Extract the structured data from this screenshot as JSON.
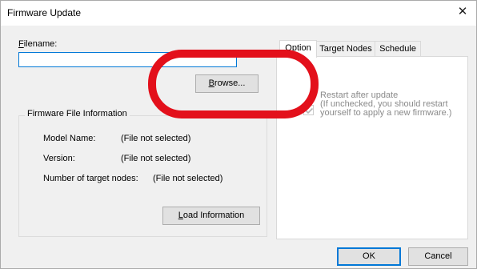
{
  "window": {
    "title": "Firmware Update",
    "close_symbol": "✕"
  },
  "filename": {
    "label_first": "F",
    "label_rest": "ilename:",
    "value": ""
  },
  "browse": {
    "label_first": "B",
    "label_rest": "rowse..."
  },
  "info_group": {
    "title": "Firmware File Information",
    "model_label": "Model Name:",
    "model_value": "(File not selected)",
    "version_label": "Version:",
    "version_value": "(File not selected)",
    "nodes_label": "Number of target nodes:",
    "nodes_value": "(File not selected)",
    "load_first": "L",
    "load_rest": "oad Information"
  },
  "tabs": [
    {
      "label": "Option",
      "active": true
    },
    {
      "label": "Target Nodes",
      "active": false
    },
    {
      "label": "Schedule",
      "active": false
    }
  ],
  "option_panel": {
    "restart_checked": true,
    "restart_enabled": false,
    "restart_label": "Restart after update",
    "restart_note": "(If unchecked, you should restart yourself to apply a new firmware.)"
  },
  "footer": {
    "ok_label": "OK",
    "cancel_label": "Cancel"
  },
  "colors": {
    "annotation": "#e3101b",
    "focus": "#0078d7"
  }
}
